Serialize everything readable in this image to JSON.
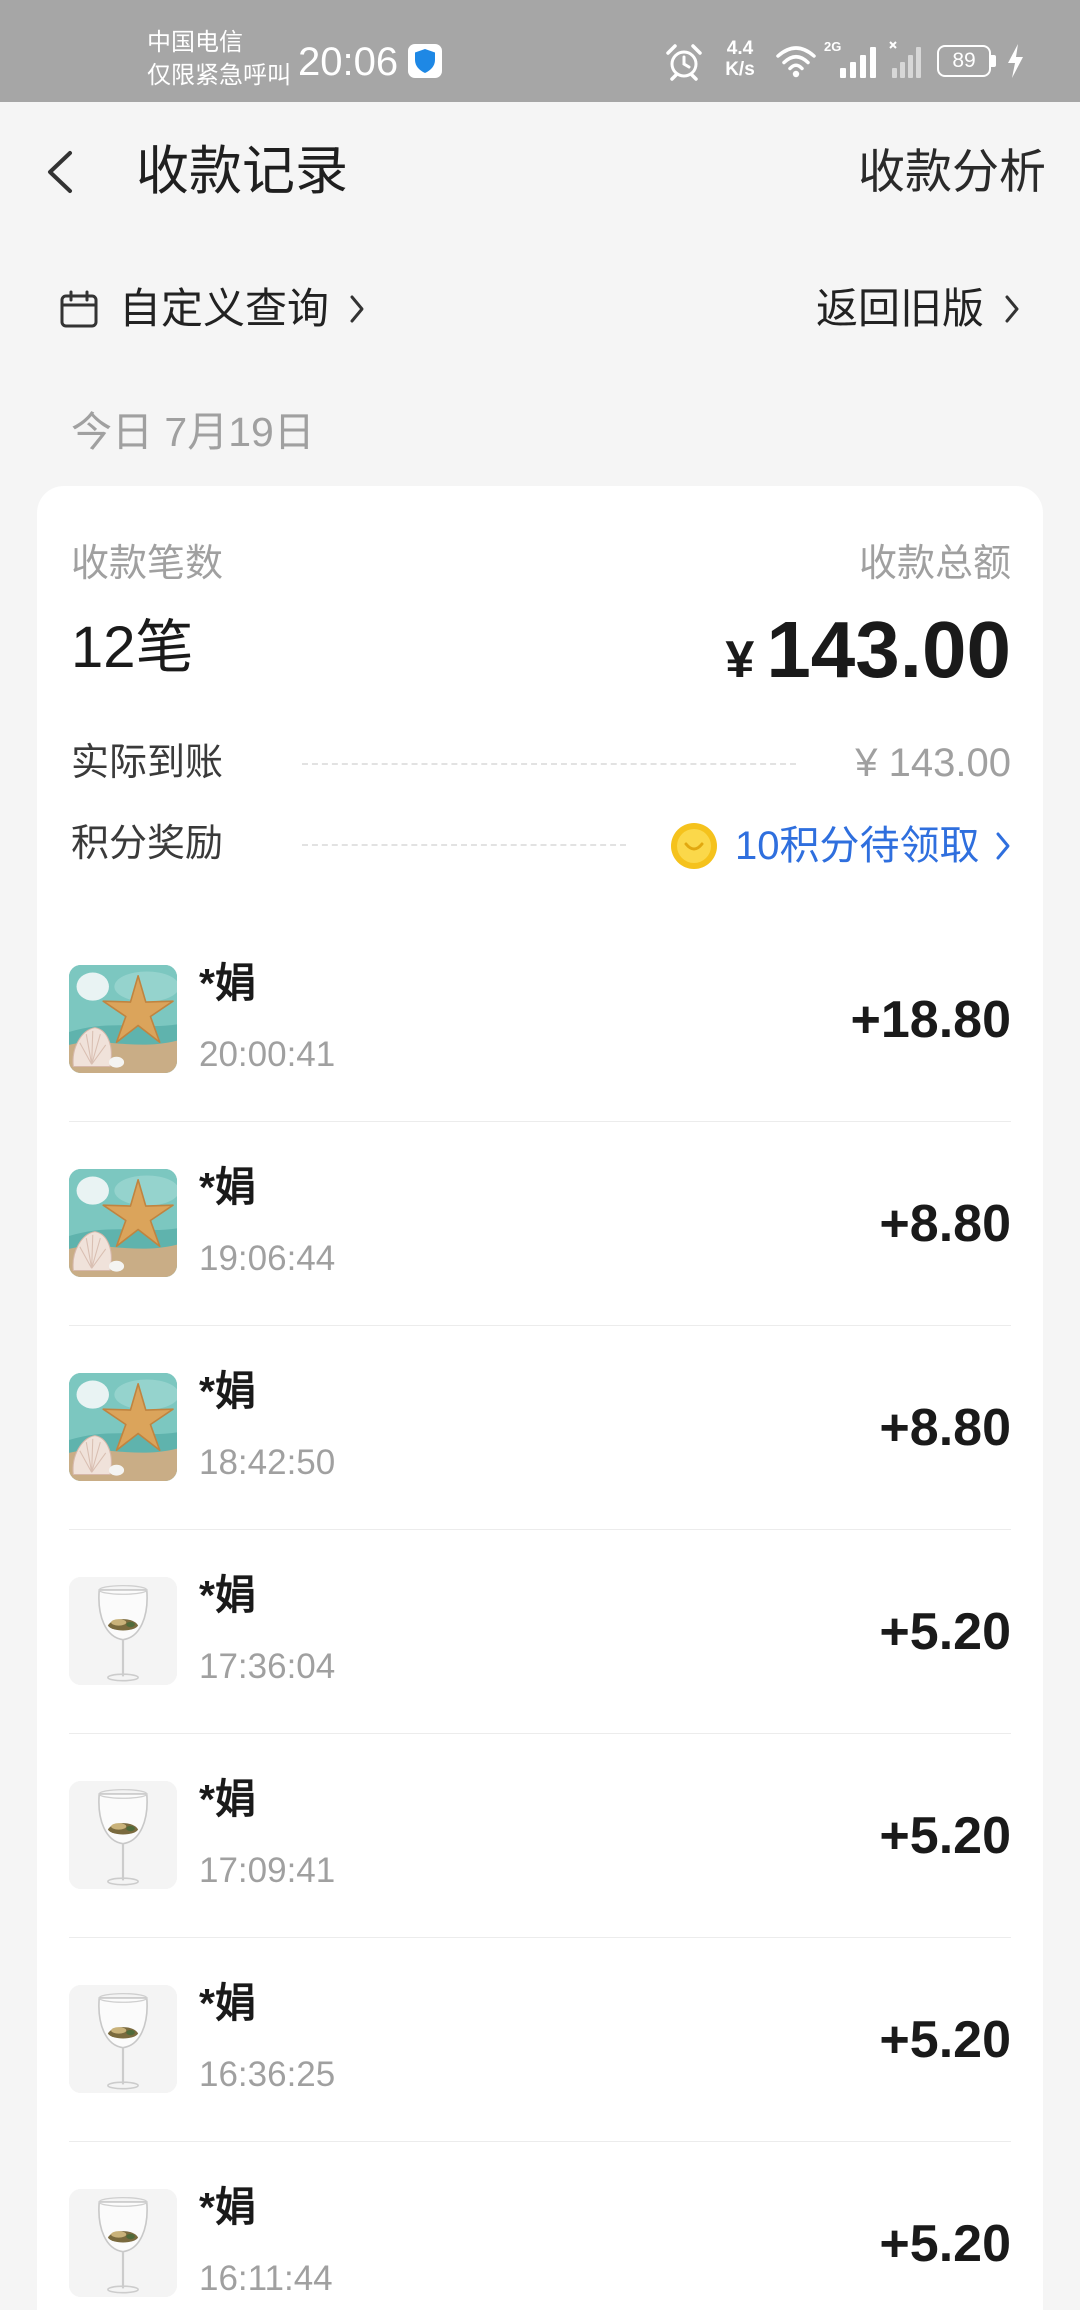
{
  "status_bar": {
    "carrier": "中国电信",
    "emergency_only": "仅限紧急呼叫",
    "time": "20:06",
    "net_speed": "4.4",
    "net_speed_unit": "K/s",
    "network_type": "2G",
    "battery_level": "89"
  },
  "header": {
    "title": "收款记录",
    "analysis_link": "收款分析"
  },
  "filters": {
    "custom_query": "自定义查询",
    "old_version": "返回旧版"
  },
  "date_label": "今日 7月19日",
  "summary": {
    "count_label": "收款笔数",
    "count_value": "12笔",
    "total_label": "收款总额",
    "currency": "¥",
    "total_value": "143.00",
    "received_label": "实际到账",
    "received_value": "¥ 143.00",
    "points_label": "积分奖励",
    "points_value": "10积分待领取"
  },
  "records": [
    {
      "name": "*娟",
      "time": "20:00:41",
      "amount": "+18.80",
      "avatar": "starfish-shell-photo"
    },
    {
      "name": "*娟",
      "time": "19:06:44",
      "amount": "+8.80",
      "avatar": "starfish-shell-photo"
    },
    {
      "name": "*娟",
      "time": "18:42:50",
      "amount": "+8.80",
      "avatar": "starfish-shell-photo"
    },
    {
      "name": "*娟",
      "time": "17:36:04",
      "amount": "+5.20",
      "avatar": "wine-glass-photo"
    },
    {
      "name": "*娟",
      "time": "17:09:41",
      "amount": "+5.20",
      "avatar": "wine-glass-photo"
    },
    {
      "name": "*娟",
      "time": "16:36:25",
      "amount": "+5.20",
      "avatar": "wine-glass-photo"
    },
    {
      "name": "*娟",
      "time": "16:11:44",
      "amount": "+5.20",
      "avatar": "wine-glass-photo"
    }
  ],
  "icons": {
    "security": "shield-icon",
    "alarm": "alarm-clock-icon",
    "wifi": "wifi-icon",
    "signal": "signal-icon",
    "no_signal": "no-signal-icon",
    "charging": "charging-bolt-icon",
    "back": "back-arrow-icon",
    "calendar": "calendar-icon",
    "chevron": "chevron-right-icon",
    "points_coin": "coin-icon"
  },
  "colors": {
    "page_bg": "#f5f5f5",
    "status_bar": "#a6a6a6",
    "card": "#ffffff",
    "accent_blue": "#2f6fde",
    "muted_text": "#a0a0a0",
    "coin": "#f5c21c"
  }
}
